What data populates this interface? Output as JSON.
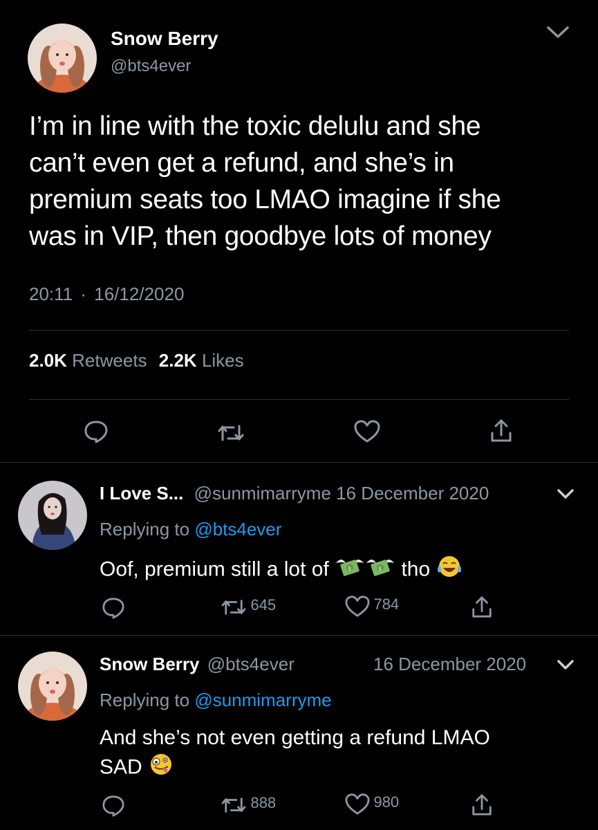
{
  "main_tweet": {
    "display_name": "Snow Berry",
    "handle": "@bts4ever",
    "text_lines": [
      "I’m in line with the toxic delulu and she",
      "can’t even get a refund, and she’s in",
      "premium seats too LMAO imagine if she",
      "was in VIP, then goodbye lots of money"
    ],
    "time": "20:11",
    "separator": "·",
    "date": "16/12/2020",
    "retweets_count": "2.0K",
    "retweets_label": "Retweets",
    "likes_count": "2.2K",
    "likes_label": "Likes"
  },
  "replies": [
    {
      "display_name": "I Love S...",
      "handle": "@sunmimarryme",
      "date": "16 December 2020",
      "replying_prefix": "Replying to",
      "replying_to": "@bts4ever",
      "text_before": "Oof, premium still a lot of",
      "text_after": "tho",
      "retweets": "645",
      "likes": "784"
    },
    {
      "display_name": "Snow Berry",
      "handle": "@bts4ever",
      "date": "16 December 2020",
      "replying_prefix": "Replying to",
      "replying_to": "@sunmimarryme",
      "text_line1": "And she’s not even getting a refund LMAO",
      "text_line2": "SAD",
      "retweets": "888",
      "likes": "980"
    }
  ],
  "icons": [
    "chevron-down-icon",
    "reply-icon",
    "retweet-icon",
    "like-icon",
    "share-icon",
    "money-with-wings-icon",
    "tears-of-joy-icon",
    "zany-face-icon"
  ],
  "colors": {
    "background": "#000000",
    "text": "#ffffff",
    "muted": "#8b98a5",
    "link": "#1d9bf0",
    "divider": "#2f3336"
  }
}
